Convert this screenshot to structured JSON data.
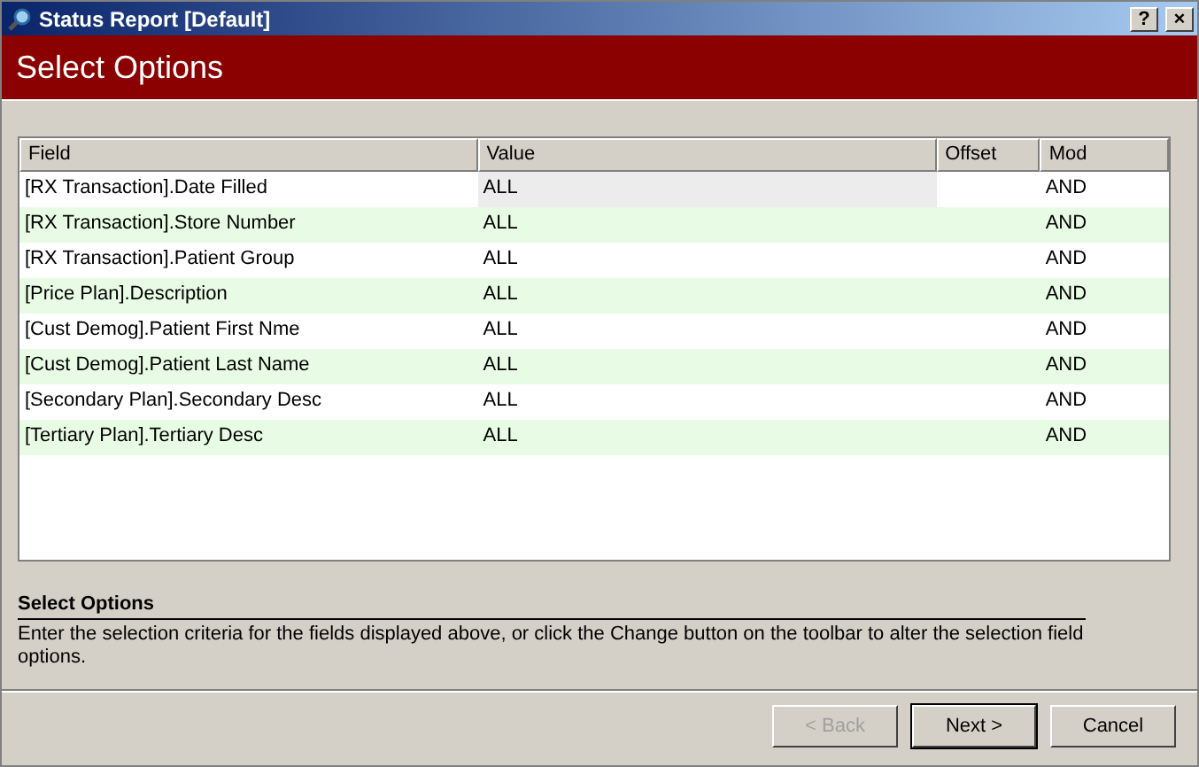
{
  "window": {
    "title": "Status Report [Default]",
    "help_button": "?",
    "close_button": "×"
  },
  "header": {
    "title": "Select Options"
  },
  "table": {
    "columns": [
      "Field",
      "Value",
      "Offset",
      "Mod"
    ],
    "rows": [
      {
        "field": "[RX Transaction].Date Filled",
        "value": "ALL",
        "offset": "",
        "mod": "AND",
        "selected": true
      },
      {
        "field": "[RX Transaction].Store Number",
        "value": "ALL",
        "mod": "AND",
        "selected": false
      },
      {
        "field": "[RX Transaction].Patient Group",
        "value": "ALL",
        "mod": "AND",
        "selected": false
      },
      {
        "field": "[Price Plan].Description",
        "value": "ALL",
        "mod": "AND",
        "selected": false
      },
      {
        "field": "[Cust Demog].Patient First Nme",
        "value": "ALL",
        "mod": "AND",
        "selected": false
      },
      {
        "field": "[Cust Demog].Patient Last Name",
        "value": "ALL",
        "mod": "AND",
        "selected": false
      },
      {
        "field": "[Secondary Plan].Secondary Desc",
        "value": "ALL",
        "mod": "AND",
        "selected": false
      },
      {
        "field": "[Tertiary Plan].Tertiary Desc",
        "value": "ALL",
        "mod": "AND",
        "selected": false
      }
    ]
  },
  "help": {
    "title": "Select Options",
    "text": "Enter the selection criteria for the fields displayed above, or click the Change button on the toolbar to alter the selection field options."
  },
  "buttons": [
    {
      "label": "< Back",
      "disabled": true,
      "default": false
    },
    {
      "label": "Next >",
      "disabled": false,
      "default": true
    },
    {
      "label": "Cancel",
      "disabled": false,
      "default": false
    }
  ]
}
